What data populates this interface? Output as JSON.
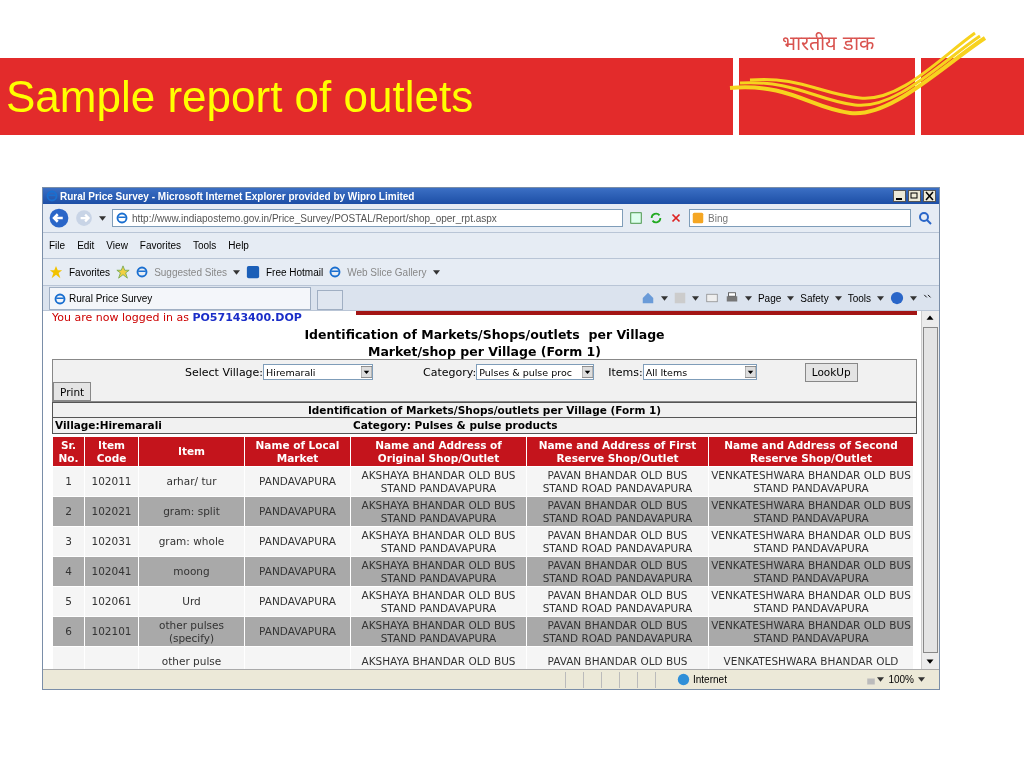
{
  "slide": {
    "logo_text": "भारतीय डाक",
    "title": "Sample report of outlets"
  },
  "browser": {
    "title": "Rural Price Survey - Microsoft Internet Explorer provided by Wipro Limited",
    "address": "http://www.indiapostemo.gov.in/Price_Survey/POSTAL/Report/shop_oper_rpt.aspx",
    "search_placeholder": "Bing",
    "menu": [
      "File",
      "Edit",
      "View",
      "Favorites",
      "Tools",
      "Help"
    ],
    "favorites_label": "Favorites",
    "links": [
      {
        "label": "Suggested Sites",
        "dropdown": true
      },
      {
        "label": "Free Hotmail",
        "dropdown": false
      },
      {
        "label": "Web Slice Gallery",
        "dropdown": true
      }
    ],
    "tab": "Rural Price Survey",
    "commands": [
      "Page",
      "Safety",
      "Tools"
    ],
    "status": {
      "zone": "Internet",
      "zoom": "100%"
    }
  },
  "page": {
    "login_text": "You are now logged in as ",
    "login_user": "PO57143400.DOP",
    "heading": [
      "Identification of Markets/Shops/outlets  per Village",
      "Market/shop per Village (Form 1)"
    ],
    "filters": [
      {
        "label": "Select Village:",
        "value": "Hiremarali"
      },
      {
        "label": "Category:",
        "value": "Pulses & pulse proc"
      },
      {
        "label": "Items:",
        "value": "All Items"
      }
    ],
    "lookup_button": "LookUp",
    "print_button": "Print",
    "report_title": "Identification of Markets/Shops/outlets per Village (Form 1)",
    "village": "Village:Hiremarali",
    "category": "Category: Pulses & pulse products",
    "table": {
      "columns": [
        "Sr. No.",
        "Item Code",
        "Item",
        "Name of Local Market",
        "Name and Address of Original Shop/Outlet",
        "Name and Address of First Reserve Shop/Outlet",
        "Name and Address of Second Reserve Shop/Outlet"
      ],
      "rows": [
        [
          "1",
          "102011",
          "arhar/ tur",
          "PANDAVAPURA",
          "AKSHAYA BHANDAR OLD BUS STAND PANDAVAPURA",
          "PAVAN BHANDAR OLD BUS STAND ROAD PANDAVAPURA",
          "VENKATESHWARA BHANDAR OLD BUS STAND PANDAVAPURA"
        ],
        [
          "2",
          "102021",
          "gram: split",
          "PANDAVAPURA",
          "AKSHAYA BHANDAR OLD BUS STAND PANDAVAPURA",
          "PAVAN BHANDAR OLD BUS STAND ROAD PANDAVAPURA",
          "VENKATESHWARA BHANDAR OLD BUS STAND PANDAVAPURA"
        ],
        [
          "3",
          "102031",
          "gram: whole",
          "PANDAVAPURA",
          "AKSHAYA BHANDAR OLD BUS STAND PANDAVAPURA",
          "PAVAN BHANDAR OLD BUS STAND ROAD PANDAVAPURA",
          "VENKATESHWARA BHANDAR OLD BUS STAND PANDAVAPURA"
        ],
        [
          "4",
          "102041",
          "moong",
          "PANDAVAPURA",
          "AKSHAYA BHANDAR OLD BUS STAND PANDAVAPURA",
          "PAVAN BHANDAR OLD BUS STAND ROAD PANDAVAPURA",
          "VENKATESHWARA BHANDAR OLD BUS STAND PANDAVAPURA"
        ],
        [
          "5",
          "102061",
          "Urd",
          "PANDAVAPURA",
          "AKSHAYA BHANDAR OLD BUS STAND PANDAVAPURA",
          "PAVAN BHANDAR OLD BUS STAND ROAD PANDAVAPURA",
          "VENKATESHWARA BHANDAR OLD BUS STAND PANDAVAPURA"
        ],
        [
          "6",
          "102101",
          "other pulses (specify)",
          "PANDAVAPURA",
          "AKSHAYA BHANDAR OLD BUS STAND PANDAVAPURA",
          "PAVAN BHANDAR OLD BUS STAND ROAD PANDAVAPURA",
          "VENKATESHWARA BHANDAR OLD BUS STAND PANDAVAPURA"
        ],
        [
          "",
          "",
          "other pulse",
          "",
          "AKSHAYA BHANDAR OLD BUS",
          "PAVAN BHANDAR OLD BUS",
          "VENKATESHWARA BHANDAR OLD"
        ]
      ]
    }
  }
}
